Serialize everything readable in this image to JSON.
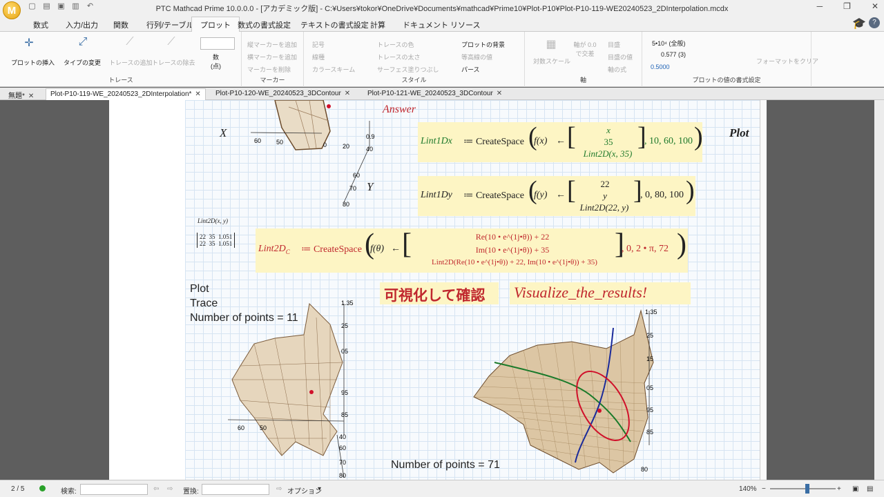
{
  "window": {
    "title": "PTC Mathcad Prime 10.0.0.0 - [アカデミック版] - C:¥Users¥tokor¥OneDrive¥Documents¥mathcad¥Prime10¥Plot-P10¥Plot-P10-119-WE20240523_2DInterpolation.mcdx",
    "logo": "M"
  },
  "menu": [
    "数式",
    "入力/出力",
    "関数",
    "行列/テーブル",
    "プロット",
    "数式の書式設定",
    "テキストの書式設定",
    "計算",
    "ドキュメント",
    "リソース"
  ],
  "ribbon": {
    "trace": {
      "insert_plot": "プロットの挿入",
      "change_type": "タイプの変更",
      "add_trace": "トレースの追加",
      "remove_trace": "トレースの除去",
      "group": "トレース"
    },
    "points": {
      "label": "数\n(点)"
    },
    "marker": {
      "vertical": "縦マーカーを追加",
      "horizontal": "横マーカーを追加",
      "delete": "マーカーを削除",
      "group": "マーカー"
    },
    "style": {
      "symbol": "記号",
      "line": "線種",
      "color_scheme": "カラースキーム",
      "trace_color": "トレースの色",
      "trace_width": "トレースの太さ",
      "surface_fill": "サーフェス塗りつぶし",
      "plot_bg": "プロットの背景",
      "contour": "等高線の値",
      "perspective": "パース",
      "group": "スタイル"
    },
    "axis": {
      "scale": "対数スケール",
      "axis_at": "軸が 0.0 で交差",
      "primary": "目盛",
      "target": "目盛の値",
      "formula": "軸の式",
      "group": "軸"
    },
    "format": {
      "v1": "5•10⁴ (全般)",
      "v2": "0.577 (3)",
      "v3": "0.5000",
      "clear": "フォーマットをクリア",
      "group": "プロットの値の書式設定"
    }
  },
  "doc_tabs": [
    "無題*",
    "Plot-P10-119-WE_20240523_2DInterpolation*",
    "Plot-P10-120-WE_20240523_3DContour",
    "Plot-P10-121-WE_20240523_3DContour"
  ],
  "worksheet": {
    "answer": "Answer",
    "axis_x": "X",
    "axis_y": "Y",
    "top_ticks_x": [
      "60",
      "50",
      "0",
      "20",
      "40"
    ],
    "top_ticks_y": [
      "60",
      "70",
      "80"
    ],
    "top_tick_z": "0.9",
    "plot_right": "Plot",
    "eq1": {
      "lhs": "Lint1Dx",
      "fn": "f(x)",
      "v": [
        "x",
        "35",
        "Lint2D(x, 35)"
      ],
      "args": ", 10, 60, 100"
    },
    "eq2": {
      "lhs": "Lint1Dy",
      "fn": "f(y)",
      "v": [
        "22",
        "y",
        "Lint2D(22, y)"
      ],
      "args": ", 0, 80, 100"
    },
    "eq3": {
      "lhs": "Lint2D",
      "lhs_sub": "C",
      "fn": "f(θ)",
      "v": [
        "Re(10 • e^(1j•θ)) + 22",
        "Im(10 • e^(1j•θ)) + 35",
        "Lint2D(Re(10 • e^(1j•θ)) + 22, Im(10 • e^(1j•θ)) + 35)"
      ],
      "args": ", 0, 2 • π, 72"
    },
    "matrix_label": "Lint2D(x, y)",
    "matrix": [
      [
        "22",
        "35",
        "1.051"
      ],
      [
        "22",
        "35",
        "1.051"
      ]
    ],
    "defs": "≔ CreateSpace",
    "plot_labels": [
      "Plot",
      "Trace",
      "Number of points = 11"
    ],
    "jp_title": "可視化して確認",
    "en_title": "Visualize_the_results!",
    "points_71": "Number of points = 71",
    "left_plot_ticks_z": [
      "1.35",
      "25",
      "05",
      "95",
      "85"
    ],
    "left_plot_ticks_x": [
      "60",
      "50"
    ],
    "left_plot_ticks_y": [
      "40",
      "60",
      "70",
      "80"
    ],
    "right_plot_ticks_z": [
      "1.35",
      "25",
      "15",
      "05",
      "95",
      "85"
    ],
    "right_plot_ticks_y": [
      "80"
    ]
  },
  "status": {
    "page": "2 / 5",
    "search": "検索:",
    "replace": "置換:",
    "options": "オプション",
    "zoom": "140%"
  },
  "colors": {
    "accent": "#ffd24d",
    "surface": "#e6d6bd",
    "red_text": "#c0282e",
    "green_text": "#1f7a2c"
  }
}
